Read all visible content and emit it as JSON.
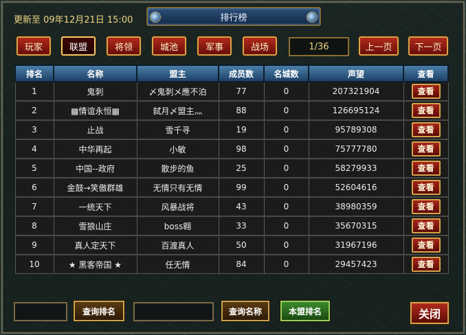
{
  "header": {
    "update_text": "更新至 09年12月21日 15:00",
    "title": "排行榜"
  },
  "tabs": [
    {
      "label": "玩家"
    },
    {
      "label": "联盟"
    },
    {
      "label": "将领"
    },
    {
      "label": "城池"
    },
    {
      "label": "军事"
    },
    {
      "label": "战场"
    }
  ],
  "active_tab": "联盟",
  "pagination": {
    "page_text": "1/36",
    "prev_label": "上一页",
    "next_label": "下一页"
  },
  "table": {
    "headers": [
      "排名",
      "名称",
      "盟主",
      "成员数",
      "名城数",
      "声望",
      "查看"
    ],
    "view_label": "查看",
    "rows": [
      {
        "rank": "1",
        "name": "鬼刺",
        "leader": "〆鬼刺メ應不泊",
        "members": "77",
        "cities": "0",
        "prestige": "207321904"
      },
      {
        "rank": "2",
        "name": "▩情谊永恒▩",
        "leader": "弑月〆盟主灬",
        "members": "88",
        "cities": "0",
        "prestige": "126695124"
      },
      {
        "rank": "3",
        "name": "止战",
        "leader": "雪千寻",
        "members": "19",
        "cities": "0",
        "prestige": "95789308"
      },
      {
        "rank": "4",
        "name": "中华再起",
        "leader": "小敏",
        "members": "98",
        "cities": "0",
        "prestige": "75777780"
      },
      {
        "rank": "5",
        "name": "中国--政府",
        "leader": "散步的鱼",
        "members": "25",
        "cities": "0",
        "prestige": "58279933"
      },
      {
        "rank": "6",
        "name": "金鼓→笑傲群雄",
        "leader": "无情只有无情",
        "members": "99",
        "cities": "0",
        "prestige": "52604616"
      },
      {
        "rank": "7",
        "name": "一统天下",
        "leader": "风暴战将",
        "members": "43",
        "cities": "0",
        "prestige": "38980359"
      },
      {
        "rank": "8",
        "name": "雪狼山庄",
        "leader": "boss翱",
        "members": "33",
        "cities": "0",
        "prestige": "35670315"
      },
      {
        "rank": "9",
        "name": "真人定天下",
        "leader": "百渡真人",
        "members": "50",
        "cities": "0",
        "prestige": "31967196"
      },
      {
        "rank": "10",
        "name": "★ 黑客帝国 ★",
        "leader": "任无情",
        "members": "84",
        "cities": "0",
        "prestige": "29457423"
      }
    ]
  },
  "bottom": {
    "rank_query_label": "查询排名",
    "name_query_label": "查询名称",
    "my_alliance_label": "本盟排名",
    "close_label": "关闭"
  }
}
